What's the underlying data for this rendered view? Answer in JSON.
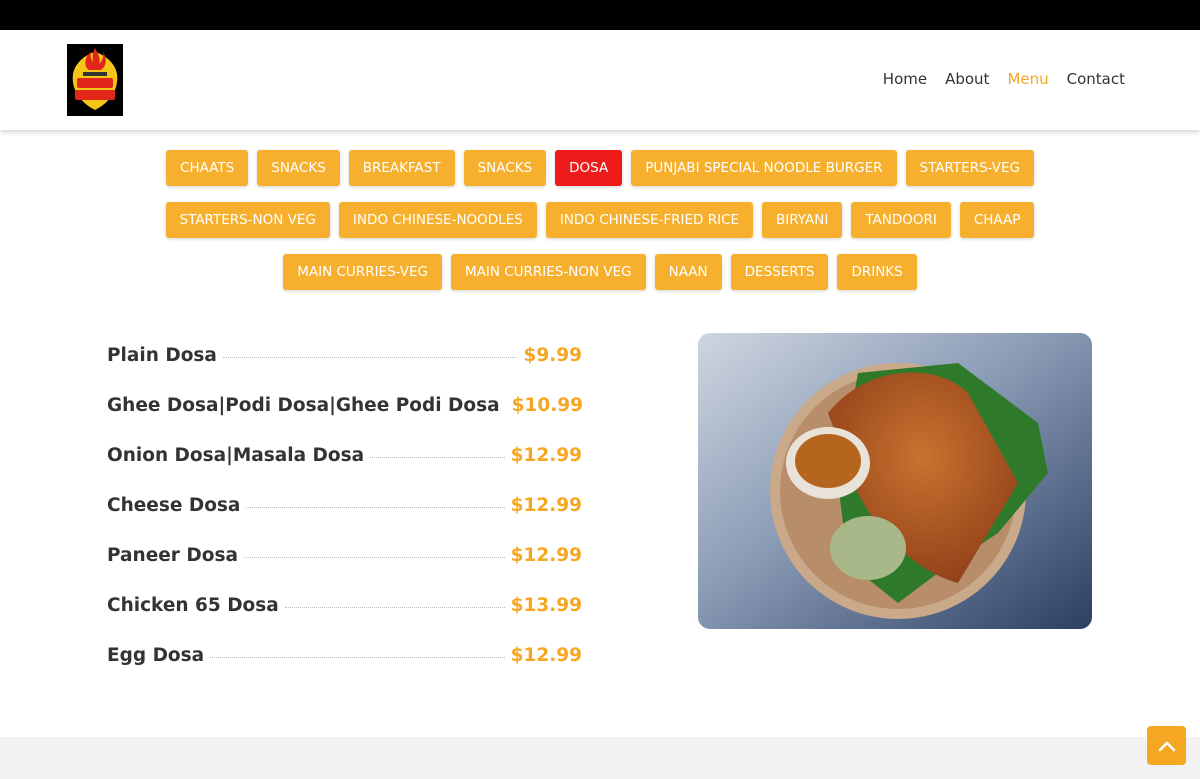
{
  "brand": {
    "logo_icon": "street-kitchen-logo",
    "colors": {
      "accent": "#f5a623",
      "button": "#f7b02e",
      "active_button": "#ee1b1b",
      "topbar": "#000000"
    }
  },
  "nav": {
    "items": [
      {
        "label": "Home"
      },
      {
        "label": "About"
      },
      {
        "label": "Menu",
        "active": true
      },
      {
        "label": "Contact"
      }
    ]
  },
  "categories": {
    "rows": [
      [
        "CHAATS",
        "SNACKS",
        "BREAKFAST",
        "SNACKS",
        "DOSA",
        "PUNJABI SPECIAL NOODLE BURGER",
        "STARTERS-VEG"
      ],
      [
        "STARTERS-NON VEG",
        "INDO CHINESE-NOODLES",
        "INDO CHINESE-FRIED RICE",
        "BIRYANI",
        "TANDOORI",
        "CHAAP"
      ],
      [
        "MAIN CURRIES-VEG",
        "MAIN CURRIES-NON VEG",
        "NAAN",
        "DESSERTS",
        "DRINKS"
      ]
    ],
    "active": "DOSA"
  },
  "menu_items": [
    {
      "name": "Plain Dosa",
      "price": "$9.99"
    },
    {
      "name": "Ghee Dosa|Podi Dosa|Ghee Podi Dosa",
      "price": "$10.99"
    },
    {
      "name": "Onion Dosa|Masala Dosa",
      "price": "$12.99"
    },
    {
      "name": "Cheese Dosa",
      "price": "$12.99"
    },
    {
      "name": "Paneer Dosa",
      "price": "$12.99"
    },
    {
      "name": "Chicken 65 Dosa",
      "price": "$13.99"
    },
    {
      "name": "Egg Dosa",
      "price": "$12.99"
    }
  ],
  "photo_icon": "dosa-photo",
  "scroll_top_icon": "chevron-up-icon"
}
